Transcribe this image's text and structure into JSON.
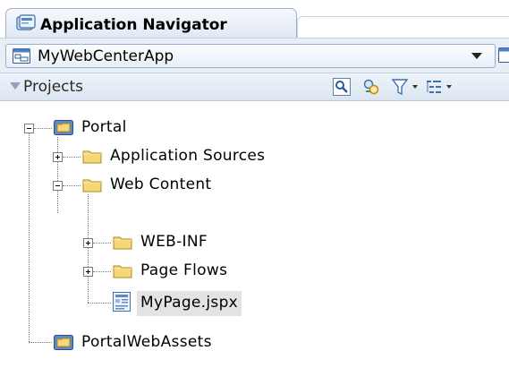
{
  "tab": {
    "title": "Application Navigator",
    "icon": "application-navigator-icon"
  },
  "app_selector": {
    "value": "MyWebCenterApp",
    "icon": "application-icon"
  },
  "projects": {
    "label": "Projects",
    "toolbar": [
      "find-icon",
      "refresh-sync-icon",
      "filter-icon",
      "view-options-icon"
    ]
  },
  "tree": {
    "portal": "Portal",
    "application_sources": "Application Sources",
    "web_content": "Web Content",
    "web_inf": "WEB-INF",
    "page_flows": "Page Flows",
    "my_page": "MyPage.jspx",
    "portal_web_assets": "PortalWebAssets"
  },
  "colors": {
    "folder": "#f5d779",
    "project_folder": "#5e88c8",
    "selection": "#e3e3e3"
  }
}
